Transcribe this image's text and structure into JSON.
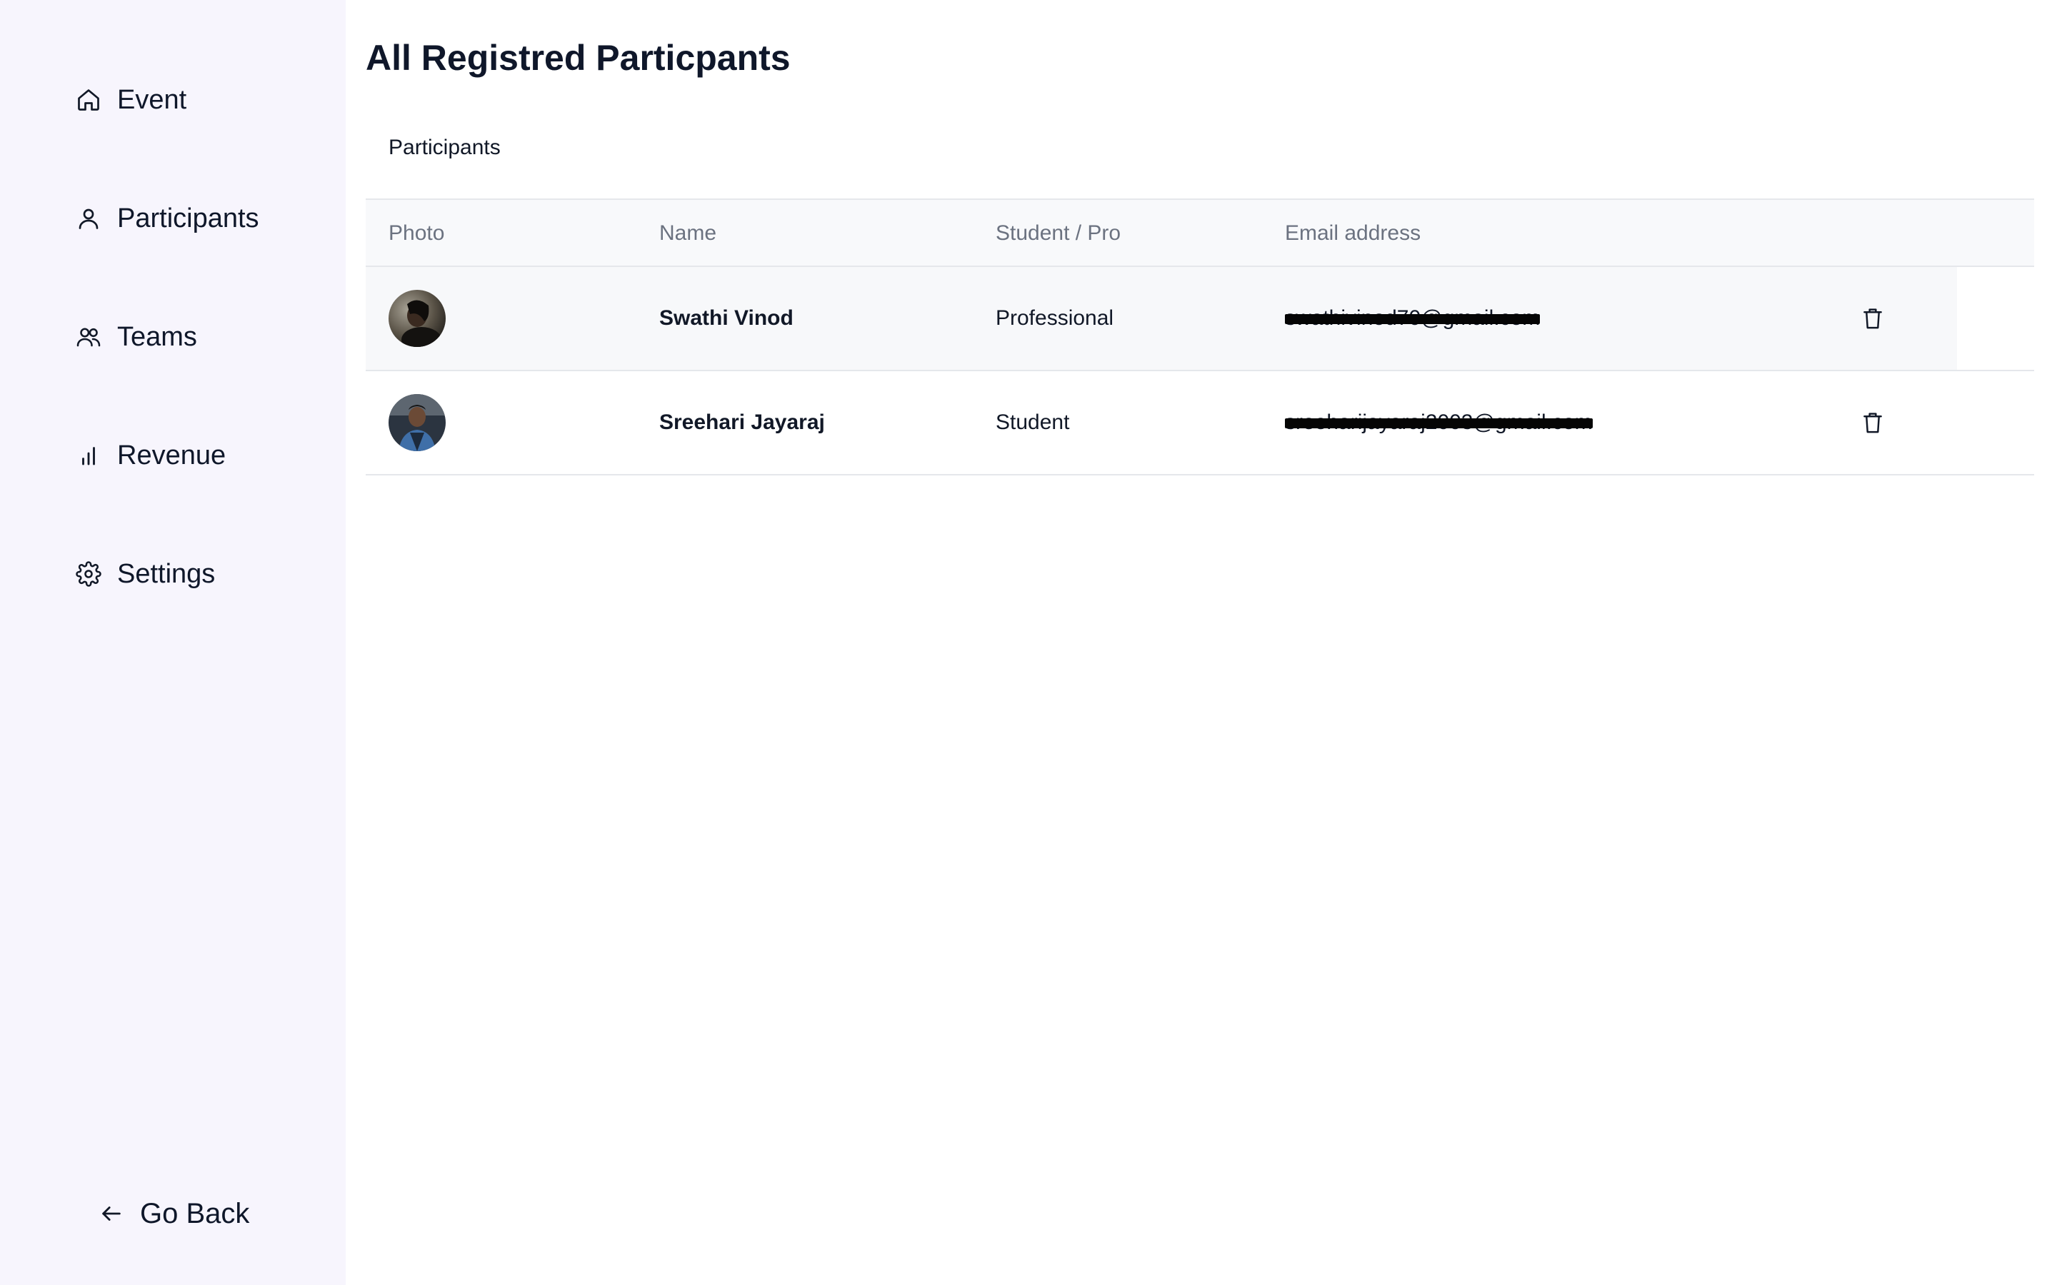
{
  "sidebar": {
    "items": [
      {
        "label": "Event",
        "icon": "home-icon"
      },
      {
        "label": "Participants",
        "icon": "user-icon"
      },
      {
        "label": "Teams",
        "icon": "users-icon"
      },
      {
        "label": "Revenue",
        "icon": "bar-chart-icon"
      },
      {
        "label": "Settings",
        "icon": "gear-icon"
      }
    ],
    "go_back": {
      "label": "Go Back",
      "icon": "arrow-left-icon"
    }
  },
  "main": {
    "title": "All Registred Particpants",
    "section_label": "Participants",
    "table": {
      "columns": [
        "Photo",
        "Name",
        "Student / Pro",
        "Email address"
      ],
      "rows": [
        {
          "name": "Swathi Vinod",
          "type": "Professional",
          "email": "swathivinod70@gmail.com",
          "email_redacted": true,
          "photo_icon": "avatar-photo"
        },
        {
          "name": "Sreehari Jayaraj",
          "type": "Student",
          "email": "sreeharijayaraj2003@gmail.com",
          "email_redacted": true,
          "photo_icon": "avatar-photo"
        }
      ]
    }
  },
  "colors": {
    "sidebar_bg": "#f7f5fd",
    "header_bg": "#f8f9fb",
    "row_highlight_bg": "#f7f8fa",
    "border": "#e5e7eb",
    "muted_text": "#6b7280"
  }
}
